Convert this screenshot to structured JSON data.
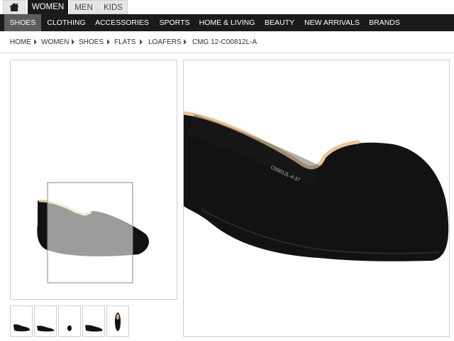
{
  "top_tabs": {
    "home_icon": "home-icon",
    "items": [
      "WOMEN",
      "MEN",
      "KIDS"
    ],
    "active": "WOMEN"
  },
  "categories": {
    "items": [
      "SHOES",
      "CLOTHING",
      "ACCESSORIES",
      "SPORTS",
      "HOME & LIVING",
      "BEAUTY",
      "NEW ARRIVALS",
      "BRANDS"
    ],
    "active": "SHOES"
  },
  "breadcrumb": [
    "HOME",
    "WOMEN",
    "SHOES",
    "FLATS",
    "LOAFERS",
    "CMG 12-C00812L-A"
  ],
  "product": {
    "insole_text": "C00812L-A 37"
  },
  "colors": {
    "nav_bg": "#1b1b1b",
    "nav_active_bg": "#5d5d5d",
    "shoe_black": "#121212",
    "piping": "#e6c79a"
  }
}
